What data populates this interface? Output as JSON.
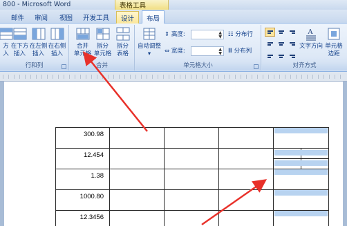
{
  "window": {
    "title": "800 - Microsoft Word",
    "context_tab_header": "表格工具"
  },
  "tabs": [
    "邮件",
    "审阅",
    "视图",
    "开发工具",
    "设计",
    "布局"
  ],
  "ribbon": {
    "rows_cols_group": {
      "label": "行和列",
      "buttons": [
        {
          "line1": "方",
          "line2": "入"
        },
        {
          "line1": "在下方",
          "line2": "插入"
        },
        {
          "line1": "在左侧",
          "line2": "插入"
        },
        {
          "line1": "在右侧",
          "line2": "插入"
        }
      ]
    },
    "merge_group": {
      "label": "合并",
      "buttons": [
        {
          "line1": "合并",
          "line2": "单元格"
        },
        {
          "line1": "拆分",
          "line2": "单元格"
        },
        {
          "line1": "拆分",
          "line2": "表格"
        }
      ]
    },
    "cell_size_group": {
      "label": "单元格大小",
      "autofit": "自动调整",
      "height_label": "高度:",
      "width_label": "宽度:",
      "distribute_rows": "分布行",
      "distribute_cols": "分布列"
    },
    "alignment_group": {
      "label": "对齐方式",
      "text_direction": "文字方向",
      "cell_margins_line1": "单元格",
      "cell_margins_line2": "边距"
    }
  },
  "table": {
    "values": [
      "300.98",
      "12.454",
      "1.38",
      "1000.80",
      "12.3456"
    ]
  },
  "colors": {
    "highlight": "#b8d3f0",
    "arrow": "#e8312a"
  }
}
